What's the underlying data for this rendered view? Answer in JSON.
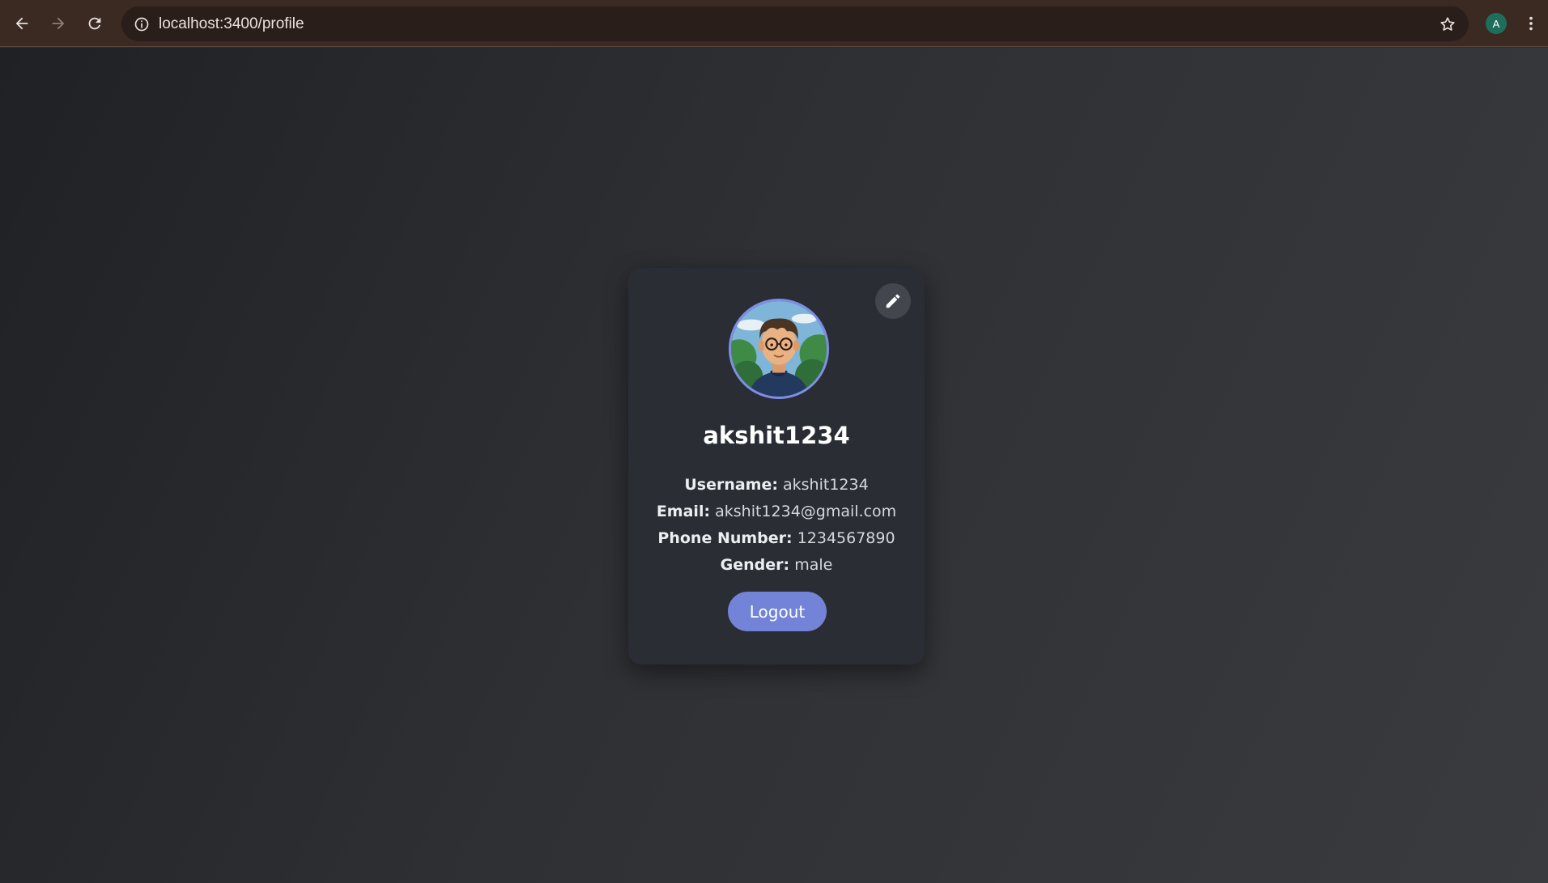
{
  "browser": {
    "url": "localhost:3400/profile",
    "profile_initial": "A",
    "icons": [
      "back-arrow-icon",
      "forward-arrow-icon",
      "reload-icon",
      "site-info-icon",
      "bookmark-star-icon",
      "more-menu-icon"
    ]
  },
  "profile": {
    "display_name": "akshit1234",
    "fields": [
      {
        "label": "Username:",
        "value": "akshit1234"
      },
      {
        "label": "Email:",
        "value": "akshit1234@gmail.com"
      },
      {
        "label": "Phone Number:",
        "value": "1234567890"
      },
      {
        "label": "Gender:",
        "value": "male"
      }
    ],
    "logout_label": "Logout",
    "edit_icon": "pencil-icon",
    "avatar_alt": "avatar"
  },
  "colors": {
    "accent": "#7384d8",
    "card": "#2a2d34",
    "avatar_ring": "#7f8ee6",
    "browser_bar": "#3a2a22"
  }
}
